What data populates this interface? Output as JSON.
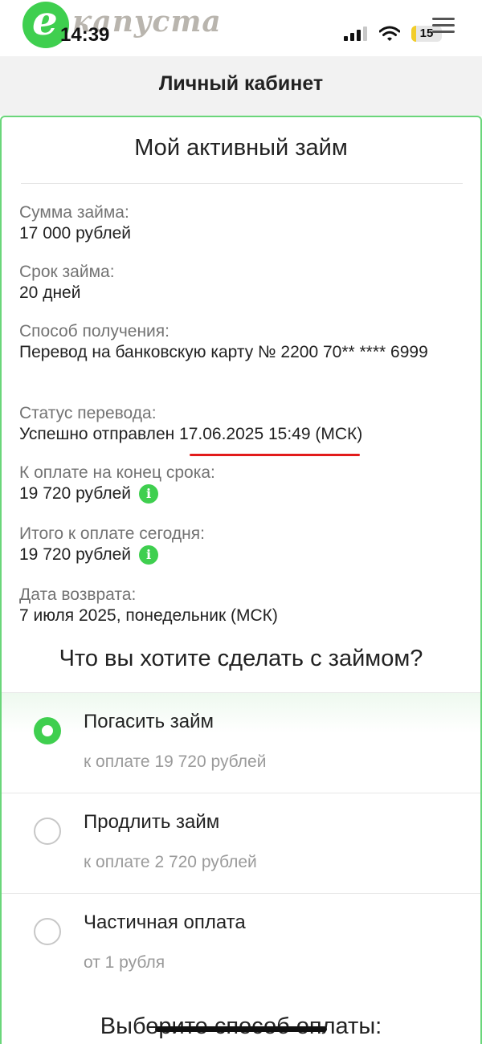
{
  "brand": {
    "logo_letter": "e",
    "logo_text": "капуста",
    "accent": "#3fcf4f"
  },
  "status_bar": {
    "time": "14:39",
    "battery": "15",
    "icons": [
      "signal-icon",
      "wifi-icon",
      "battery-icon"
    ]
  },
  "header": {
    "title": "Личный кабинет",
    "menu_icon": "hamburger-menu-icon"
  },
  "loan": {
    "title": "Мой активный займ",
    "fields": [
      {
        "label": "Сумма займа:",
        "value": "17 000 рублей"
      },
      {
        "label": "Срок займа:",
        "value": "20 дней"
      },
      {
        "label": "Способ получения:",
        "value": "Перевод на банковскую карту № 2200 70** **** 6999"
      },
      {
        "label": "Статус перевода:",
        "value": "Успешно отправлен 17.06.2025 15:49 (МСК)"
      },
      {
        "label": "К оплате на конец срока:",
        "value": "19 720 рублей"
      },
      {
        "label": "Итого к оплате сегодня:",
        "value": "19 720 рублей"
      },
      {
        "label": "Дата возврата:",
        "value": "7 июля 2025, понедельник (МСК)"
      }
    ],
    "info_icon": "i"
  },
  "actions": {
    "question": "Что вы хотите сделать с займом?",
    "options": [
      {
        "title": "Погасить займ",
        "subtitle": "к оплате 19 720 рублей",
        "selected": true
      },
      {
        "title": "Продлить займ",
        "subtitle": "к оплате 2 720 рублей",
        "selected": false
      },
      {
        "title": "Частичная оплата",
        "subtitle": "от 1 рубля",
        "selected": false
      }
    ]
  },
  "payment": {
    "title": "Выберите способ оплаты:"
  }
}
